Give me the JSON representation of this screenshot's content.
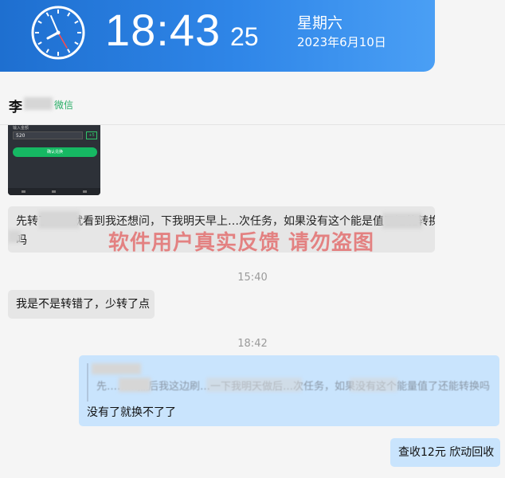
{
  "clock": {
    "time": "18:43",
    "seconds": "25",
    "weekday": "星期六",
    "date": "2023年6月10日"
  },
  "chat_header": {
    "contact_name": "李",
    "contact_source": "微信"
  },
  "thumbnail": {
    "label": "输入金额",
    "input_value": "520",
    "tag": "+5",
    "button": "确认兑换"
  },
  "messages": {
    "msg1_line1": "先转了……就看到我还想问，下我明天早上…次任务，如果没有这个能是值了还能转换",
    "msg1_line2": "吗",
    "watermark": "软件用户真实反馈  请勿盗图",
    "time1": "15:40",
    "msg2": "我是不是转错了，少转了点",
    "time2": "18:42",
    "msg3_quote": "先………然后我这边刷…一下我明天做后…次任务，如果没有这个能量值了还能转换吗",
    "msg3_reply": "没有了就换不了了",
    "msg4": "查收12元  欣动回收"
  },
  "colors": {
    "clock_bar": "#2f86e8",
    "incoming_bubble": "#e6e6e6",
    "outgoing_bubble": "#c9e4fd",
    "watermark": "#e25a5a",
    "source_green": "#2aae67"
  }
}
